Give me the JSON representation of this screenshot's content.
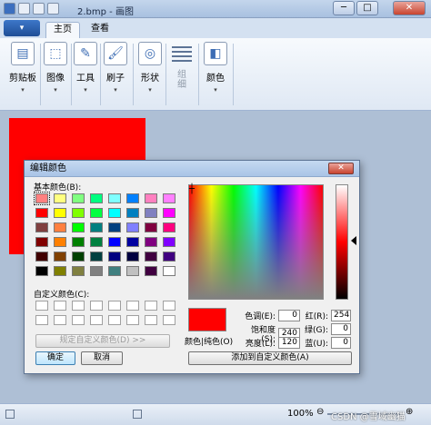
{
  "window": {
    "title": "2.bmp - 画图",
    "minimize": "─",
    "maximize": "□",
    "close": "✕"
  },
  "ribbon": {
    "app_menu": "▾",
    "tabs": [
      {
        "label": "主页",
        "active": true
      },
      {
        "label": "查看",
        "active": false
      }
    ],
    "groups": [
      {
        "label": "剪贴板",
        "icon": "clipboard-icon"
      },
      {
        "label": "图像",
        "icon": "image-select-icon"
      },
      {
        "label": "工具",
        "icon": "tools-icon"
      },
      {
        "label": "刷子",
        "icon": "brush-icon"
      },
      {
        "label": "形状",
        "icon": "shapes-icon"
      },
      {
        "label": "组\n细",
        "icon": "line-width-icon",
        "disabled": true
      },
      {
        "label": "颜色",
        "icon": "colors-icon"
      }
    ],
    "dropdown_arrow": "▾"
  },
  "statusbar": {
    "zoom": "100%",
    "minus": "⊖",
    "plus": "⊕"
  },
  "watermark": "CSDN @雪域幽猫",
  "dialog": {
    "title": "编辑颜色",
    "close": "✕",
    "basic_colors_label": "基本颜色(B):",
    "custom_colors_label": "自定义颜色(C):",
    "define_custom_button": "规定自定义颜色(D) >>",
    "ok_button": "确定",
    "cancel_button": "取消",
    "preview_label": "颜色|纯色(O)",
    "add_custom_button": "添加到自定义颜色(A)",
    "basic_colors": [
      "#ff8080",
      "#ffff80",
      "#80ff80",
      "#00ff80",
      "#80ffff",
      "#0080ff",
      "#ff80c0",
      "#ff80ff",
      "#ff0000",
      "#ffff00",
      "#80ff00",
      "#00ff40",
      "#00ffff",
      "#0080c0",
      "#8080c0",
      "#ff00ff",
      "#804040",
      "#ff8040",
      "#00ff00",
      "#008080",
      "#004080",
      "#8080ff",
      "#800040",
      "#ff0080",
      "#800000",
      "#ff8000",
      "#008000",
      "#008040",
      "#0000ff",
      "#0000a0",
      "#800080",
      "#8000ff",
      "#400000",
      "#804000",
      "#004000",
      "#004040",
      "#000080",
      "#000040",
      "#400040",
      "#400080",
      "#000000",
      "#808000",
      "#808040",
      "#808080",
      "#408080",
      "#c0c0c0",
      "#400040",
      "#ffffff"
    ],
    "selected_basic_index": 0,
    "fields": {
      "hue": {
        "label": "色调(E):",
        "value": "0"
      },
      "sat": {
        "label": "饱和度(S):",
        "value": "240"
      },
      "lum": {
        "label": "亮度(L):",
        "value": "120"
      },
      "red": {
        "label": "红(R):",
        "value": "254"
      },
      "green": {
        "label": "绿(G):",
        "value": "0"
      },
      "blue": {
        "label": "蓝(U):",
        "value": "0"
      }
    },
    "current_color": "#ff0000"
  }
}
